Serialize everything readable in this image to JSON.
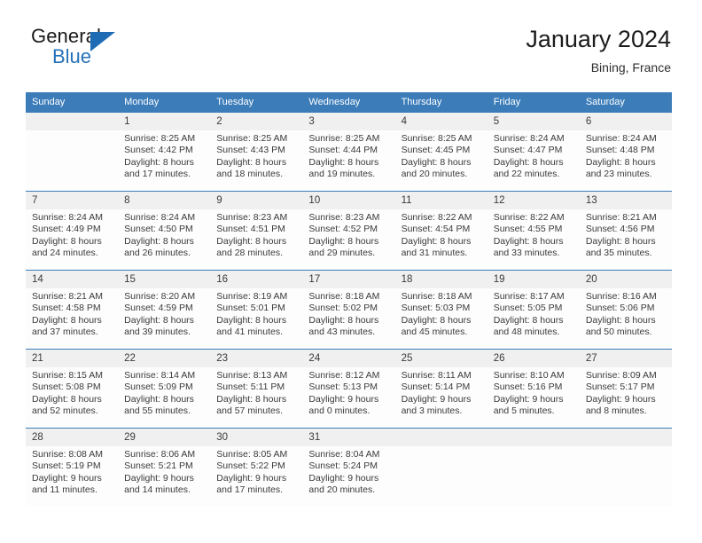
{
  "brand": {
    "name_part1": "General",
    "name_part2": "Blue",
    "triangle_color": "#1f6cb4",
    "blue_text_color": "#2572b8"
  },
  "header": {
    "title": "January 2024",
    "location": "Bining, France"
  },
  "theme": {
    "header_blue": "#3b7cb9",
    "daynum_strip": "#f0f0f0",
    "separator_blue": "#3b7cb9",
    "text": "#3a3a3a"
  },
  "weekday_headers": [
    "Sunday",
    "Monday",
    "Tuesday",
    "Wednesday",
    "Thursday",
    "Friday",
    "Saturday"
  ],
  "labels": {
    "sunrise_prefix": "Sunrise:",
    "sunset_prefix": "Sunset:",
    "daylight_prefix": "Daylight:"
  },
  "weeks": [
    {
      "days": [
        {
          "num": "",
          "empty": true,
          "l1": "",
          "l2": "",
          "l3": "",
          "l4": ""
        },
        {
          "num": "1",
          "empty": false,
          "l1": "Sunrise: 8:25 AM",
          "l2": "Sunset: 4:42 PM",
          "l3": "Daylight: 8 hours",
          "l4": "and 17 minutes."
        },
        {
          "num": "2",
          "empty": false,
          "l1": "Sunrise: 8:25 AM",
          "l2": "Sunset: 4:43 PM",
          "l3": "Daylight: 8 hours",
          "l4": "and 18 minutes."
        },
        {
          "num": "3",
          "empty": false,
          "l1": "Sunrise: 8:25 AM",
          "l2": "Sunset: 4:44 PM",
          "l3": "Daylight: 8 hours",
          "l4": "and 19 minutes."
        },
        {
          "num": "4",
          "empty": false,
          "l1": "Sunrise: 8:25 AM",
          "l2": "Sunset: 4:45 PM",
          "l3": "Daylight: 8 hours",
          "l4": "and 20 minutes."
        },
        {
          "num": "5",
          "empty": false,
          "l1": "Sunrise: 8:24 AM",
          "l2": "Sunset: 4:47 PM",
          "l3": "Daylight: 8 hours",
          "l4": "and 22 minutes."
        },
        {
          "num": "6",
          "empty": false,
          "l1": "Sunrise: 8:24 AM",
          "l2": "Sunset: 4:48 PM",
          "l3": "Daylight: 8 hours",
          "l4": "and 23 minutes."
        }
      ]
    },
    {
      "days": [
        {
          "num": "7",
          "empty": false,
          "l1": "Sunrise: 8:24 AM",
          "l2": "Sunset: 4:49 PM",
          "l3": "Daylight: 8 hours",
          "l4": "and 24 minutes."
        },
        {
          "num": "8",
          "empty": false,
          "l1": "Sunrise: 8:24 AM",
          "l2": "Sunset: 4:50 PM",
          "l3": "Daylight: 8 hours",
          "l4": "and 26 minutes."
        },
        {
          "num": "9",
          "empty": false,
          "l1": "Sunrise: 8:23 AM",
          "l2": "Sunset: 4:51 PM",
          "l3": "Daylight: 8 hours",
          "l4": "and 28 minutes."
        },
        {
          "num": "10",
          "empty": false,
          "l1": "Sunrise: 8:23 AM",
          "l2": "Sunset: 4:52 PM",
          "l3": "Daylight: 8 hours",
          "l4": "and 29 minutes."
        },
        {
          "num": "11",
          "empty": false,
          "l1": "Sunrise: 8:22 AM",
          "l2": "Sunset: 4:54 PM",
          "l3": "Daylight: 8 hours",
          "l4": "and 31 minutes."
        },
        {
          "num": "12",
          "empty": false,
          "l1": "Sunrise: 8:22 AM",
          "l2": "Sunset: 4:55 PM",
          "l3": "Daylight: 8 hours",
          "l4": "and 33 minutes."
        },
        {
          "num": "13",
          "empty": false,
          "l1": "Sunrise: 8:21 AM",
          "l2": "Sunset: 4:56 PM",
          "l3": "Daylight: 8 hours",
          "l4": "and 35 minutes."
        }
      ]
    },
    {
      "days": [
        {
          "num": "14",
          "empty": false,
          "l1": "Sunrise: 8:21 AM",
          "l2": "Sunset: 4:58 PM",
          "l3": "Daylight: 8 hours",
          "l4": "and 37 minutes."
        },
        {
          "num": "15",
          "empty": false,
          "l1": "Sunrise: 8:20 AM",
          "l2": "Sunset: 4:59 PM",
          "l3": "Daylight: 8 hours",
          "l4": "and 39 minutes."
        },
        {
          "num": "16",
          "empty": false,
          "l1": "Sunrise: 8:19 AM",
          "l2": "Sunset: 5:01 PM",
          "l3": "Daylight: 8 hours",
          "l4": "and 41 minutes."
        },
        {
          "num": "17",
          "empty": false,
          "l1": "Sunrise: 8:18 AM",
          "l2": "Sunset: 5:02 PM",
          "l3": "Daylight: 8 hours",
          "l4": "and 43 minutes."
        },
        {
          "num": "18",
          "empty": false,
          "l1": "Sunrise: 8:18 AM",
          "l2": "Sunset: 5:03 PM",
          "l3": "Daylight: 8 hours",
          "l4": "and 45 minutes."
        },
        {
          "num": "19",
          "empty": false,
          "l1": "Sunrise: 8:17 AM",
          "l2": "Sunset: 5:05 PM",
          "l3": "Daylight: 8 hours",
          "l4": "and 48 minutes."
        },
        {
          "num": "20",
          "empty": false,
          "l1": "Sunrise: 8:16 AM",
          "l2": "Sunset: 5:06 PM",
          "l3": "Daylight: 8 hours",
          "l4": "and 50 minutes."
        }
      ]
    },
    {
      "days": [
        {
          "num": "21",
          "empty": false,
          "l1": "Sunrise: 8:15 AM",
          "l2": "Sunset: 5:08 PM",
          "l3": "Daylight: 8 hours",
          "l4": "and 52 minutes."
        },
        {
          "num": "22",
          "empty": false,
          "l1": "Sunrise: 8:14 AM",
          "l2": "Sunset: 5:09 PM",
          "l3": "Daylight: 8 hours",
          "l4": "and 55 minutes."
        },
        {
          "num": "23",
          "empty": false,
          "l1": "Sunrise: 8:13 AM",
          "l2": "Sunset: 5:11 PM",
          "l3": "Daylight: 8 hours",
          "l4": "and 57 minutes."
        },
        {
          "num": "24",
          "empty": false,
          "l1": "Sunrise: 8:12 AM",
          "l2": "Sunset: 5:13 PM",
          "l3": "Daylight: 9 hours",
          "l4": "and 0 minutes."
        },
        {
          "num": "25",
          "empty": false,
          "l1": "Sunrise: 8:11 AM",
          "l2": "Sunset: 5:14 PM",
          "l3": "Daylight: 9 hours",
          "l4": "and 3 minutes."
        },
        {
          "num": "26",
          "empty": false,
          "l1": "Sunrise: 8:10 AM",
          "l2": "Sunset: 5:16 PM",
          "l3": "Daylight: 9 hours",
          "l4": "and 5 minutes."
        },
        {
          "num": "27",
          "empty": false,
          "l1": "Sunrise: 8:09 AM",
          "l2": "Sunset: 5:17 PM",
          "l3": "Daylight: 9 hours",
          "l4": "and 8 minutes."
        }
      ]
    },
    {
      "days": [
        {
          "num": "28",
          "empty": false,
          "l1": "Sunrise: 8:08 AM",
          "l2": "Sunset: 5:19 PM",
          "l3": "Daylight: 9 hours",
          "l4": "and 11 minutes."
        },
        {
          "num": "29",
          "empty": false,
          "l1": "Sunrise: 8:06 AM",
          "l2": "Sunset: 5:21 PM",
          "l3": "Daylight: 9 hours",
          "l4": "and 14 minutes."
        },
        {
          "num": "30",
          "empty": false,
          "l1": "Sunrise: 8:05 AM",
          "l2": "Sunset: 5:22 PM",
          "l3": "Daylight: 9 hours",
          "l4": "and 17 minutes."
        },
        {
          "num": "31",
          "empty": false,
          "l1": "Sunrise: 8:04 AM",
          "l2": "Sunset: 5:24 PM",
          "l3": "Daylight: 9 hours",
          "l4": "and 20 minutes."
        },
        {
          "num": "",
          "empty": true,
          "l1": "",
          "l2": "",
          "l3": "",
          "l4": ""
        },
        {
          "num": "",
          "empty": true,
          "l1": "",
          "l2": "",
          "l3": "",
          "l4": ""
        },
        {
          "num": "",
          "empty": true,
          "l1": "",
          "l2": "",
          "l3": "",
          "l4": ""
        }
      ]
    }
  ]
}
